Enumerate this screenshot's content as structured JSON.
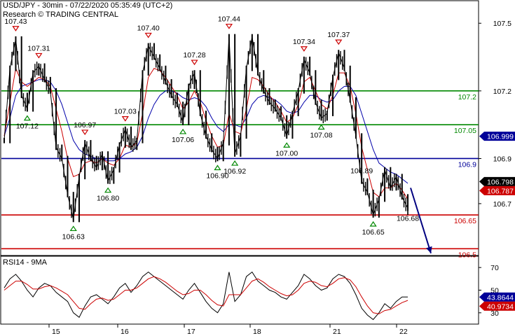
{
  "header": {
    "line1": "USD/JPY - 30min - 07/22/2020 05:35:49 (UTC+2)",
    "line2": "Research © TRADING CENTRAL"
  },
  "chart_data": [
    {
      "type": "line",
      "pair": "USD/JPY",
      "timeframe": "30min",
      "x_ticks": [
        "15",
        "16",
        "17",
        "18",
        "21",
        "22"
      ],
      "ylim": [
        106.47,
        107.6
      ],
      "y_ticks": [
        "106.7",
        "106.9",
        "107.2",
        "107.5"
      ],
      "colors": {
        "price": "#000000",
        "ma_fast": "#cc0000",
        "ma_slow": "#0000aa",
        "green_level": "#008800",
        "red_level": "#cc0000",
        "blue_level": "#000099",
        "forecast_arrow": "#000080"
      },
      "price_series": [
        106.98,
        107.3,
        107.43,
        107.18,
        107.12,
        107.28,
        107.31,
        107.25,
        107.2,
        106.95,
        106.9,
        106.74,
        106.63,
        106.82,
        106.97,
        106.9,
        106.86,
        106.92,
        106.8,
        106.85,
        106.96,
        107.03,
        106.95,
        106.98,
        107.28,
        107.4,
        107.35,
        107.3,
        107.24,
        107.18,
        107.14,
        107.06,
        107.22,
        107.28,
        107.1,
        107.0,
        106.94,
        106.9,
        106.97,
        107.44,
        106.92,
        107.0,
        107.3,
        107.44,
        107.28,
        107.2,
        107.15,
        107.12,
        107.08,
        107.0,
        107.1,
        107.2,
        107.34,
        107.28,
        107.15,
        107.08,
        107.1,
        107.26,
        107.37,
        107.3,
        107.16,
        107.0,
        106.8,
        106.75,
        106.65,
        106.72,
        106.85,
        106.77,
        106.82,
        106.73,
        106.68
      ],
      "ma_fast": [
        107.0,
        107.15,
        107.3,
        107.24,
        107.22,
        107.24,
        107.26,
        107.25,
        107.22,
        107.12,
        107.02,
        106.9,
        106.82,
        106.83,
        106.88,
        106.89,
        106.88,
        106.9,
        106.88,
        106.87,
        106.9,
        106.96,
        106.95,
        106.97,
        107.1,
        107.26,
        107.3,
        107.29,
        107.26,
        107.22,
        107.18,
        107.12,
        107.15,
        107.2,
        107.15,
        107.07,
        107.0,
        106.95,
        106.96,
        107.1,
        107.02,
        107.01,
        107.12,
        107.26,
        107.25,
        107.22,
        107.18,
        107.15,
        107.11,
        107.06,
        107.08,
        107.14,
        107.24,
        107.26,
        107.2,
        107.14,
        107.12,
        107.18,
        107.28,
        107.28,
        107.22,
        107.1,
        106.95,
        106.85,
        106.75,
        106.73,
        106.77,
        106.77,
        106.79,
        106.76,
        106.72
      ],
      "ma_slow": [
        107.0,
        107.08,
        107.18,
        107.22,
        107.23,
        107.24,
        107.25,
        107.25,
        107.24,
        107.2,
        107.14,
        107.06,
        106.98,
        106.94,
        106.92,
        106.91,
        106.9,
        106.9,
        106.89,
        106.89,
        106.9,
        106.92,
        106.93,
        106.95,
        107.0,
        107.08,
        107.14,
        107.18,
        107.2,
        107.2,
        107.19,
        107.17,
        107.16,
        107.17,
        107.16,
        107.13,
        107.08,
        107.04,
        107.02,
        107.05,
        107.05,
        107.04,
        107.08,
        107.14,
        107.17,
        107.18,
        107.17,
        107.16,
        107.14,
        107.11,
        107.1,
        107.11,
        107.15,
        107.18,
        107.18,
        107.16,
        107.15,
        107.16,
        107.2,
        107.22,
        107.22,
        107.18,
        107.1,
        107.02,
        106.94,
        106.88,
        106.86,
        106.84,
        106.83,
        106.81,
        106.79
      ],
      "levels": [
        {
          "label": "107.2",
          "value": 107.2,
          "kind": "green"
        },
        {
          "label": "107.05",
          "value": 107.05,
          "kind": "green"
        },
        {
          "label": "106.9",
          "value": 106.9,
          "kind": "blue"
        },
        {
          "label": "106.65",
          "value": 106.65,
          "kind": "red"
        },
        {
          "label": "106.5",
          "value": 106.5,
          "kind": "red"
        }
      ],
      "price_tags": [
        {
          "label": "106.999",
          "value": 106.999,
          "color": "#000099"
        },
        {
          "label": "106.798",
          "value": 106.798,
          "color": "#000000"
        },
        {
          "label": "106.787",
          "value": 106.787,
          "color": "#cc0000"
        }
      ],
      "annotations": [
        {
          "label": "107.43",
          "i": 2,
          "value": 107.43,
          "marker": "down"
        },
        {
          "label": "107.12",
          "i": 4,
          "value": 107.12,
          "marker": "up"
        },
        {
          "label": "107.31",
          "i": 6,
          "value": 107.31,
          "marker": "down"
        },
        {
          "label": "106.63",
          "i": 12,
          "value": 106.63,
          "marker": "up"
        },
        {
          "label": "106.97",
          "i": 14,
          "value": 106.97,
          "marker": "down"
        },
        {
          "label": "106.80",
          "i": 18,
          "value": 106.8,
          "marker": "up"
        },
        {
          "label": "107.03",
          "i": 21,
          "value": 107.03,
          "marker": "down"
        },
        {
          "label": "107.40",
          "i": 25,
          "value": 107.4,
          "marker": "down"
        },
        {
          "label": "107.06",
          "i": 31,
          "value": 107.06,
          "marker": "up"
        },
        {
          "label": "107.28",
          "i": 33,
          "value": 107.28,
          "marker": "down"
        },
        {
          "label": "106.90",
          "i": 37,
          "value": 106.9,
          "marker": "up"
        },
        {
          "label": "107.44",
          "i": 39,
          "value": 107.44,
          "marker": "down"
        },
        {
          "label": "106.92",
          "i": 40,
          "value": 106.92,
          "marker": "up"
        },
        {
          "label": "107.00",
          "i": 49,
          "value": 107.0,
          "marker": "up"
        },
        {
          "label": "107.34",
          "i": 52,
          "value": 107.34,
          "marker": "down"
        },
        {
          "label": "107.08",
          "i": 55,
          "value": 107.08,
          "marker": "up"
        },
        {
          "label": "107.37",
          "i": 58,
          "value": 107.37,
          "marker": "down"
        },
        {
          "label": "106.89",
          "i": 62,
          "value": 106.89,
          "marker": "none"
        },
        {
          "label": "106.65",
          "i": 64,
          "value": 106.65,
          "marker": "up"
        },
        {
          "label": "106.68",
          "i": 70,
          "value": 106.68,
          "marker": "none"
        }
      ],
      "forecast": {
        "from_value": 106.77,
        "to_value": 106.48
      }
    },
    {
      "type": "line",
      "title": "RSI14 - 9MA",
      "ylim": [
        20,
        80
      ],
      "y_ticks": [
        "70",
        "50",
        "30"
      ],
      "colors": {
        "rsi": "#000000",
        "ma": "#cc0000"
      },
      "rsi": [
        52,
        60,
        64,
        58,
        50,
        44,
        52,
        56,
        54,
        48,
        44,
        40,
        30,
        26,
        36,
        44,
        46,
        42,
        38,
        44,
        52,
        56,
        48,
        54,
        62,
        66,
        62,
        58,
        54,
        50,
        46,
        42,
        50,
        56,
        48,
        40,
        34,
        30,
        38,
        66,
        40,
        46,
        62,
        66,
        58,
        54,
        50,
        48,
        44,
        42,
        48,
        54,
        64,
        60,
        54,
        50,
        52,
        60,
        64,
        62,
        56,
        46,
        34,
        28,
        24,
        30,
        38,
        34,
        40,
        44,
        44
      ],
      "rsi_ma": [
        50,
        54,
        58,
        58,
        55,
        51,
        51,
        53,
        54,
        52,
        49,
        46,
        40,
        34,
        33,
        38,
        42,
        43,
        41,
        42,
        46,
        50,
        50,
        52,
        56,
        60,
        62,
        60,
        57,
        53,
        49,
        46,
        47,
        50,
        50,
        46,
        41,
        37,
        36,
        46,
        46,
        46,
        52,
        58,
        60,
        57,
        53,
        50,
        47,
        45,
        46,
        50,
        56,
        58,
        57,
        54,
        53,
        56,
        60,
        61,
        59,
        53,
        44,
        36,
        30,
        29,
        32,
        33,
        36,
        39,
        41
      ],
      "tags": [
        {
          "label": "43.8644",
          "value": 43.8644,
          "color": "#000099"
        },
        {
          "label": "40.9734",
          "value": 40.9734,
          "color": "#cc0000"
        }
      ]
    }
  ]
}
